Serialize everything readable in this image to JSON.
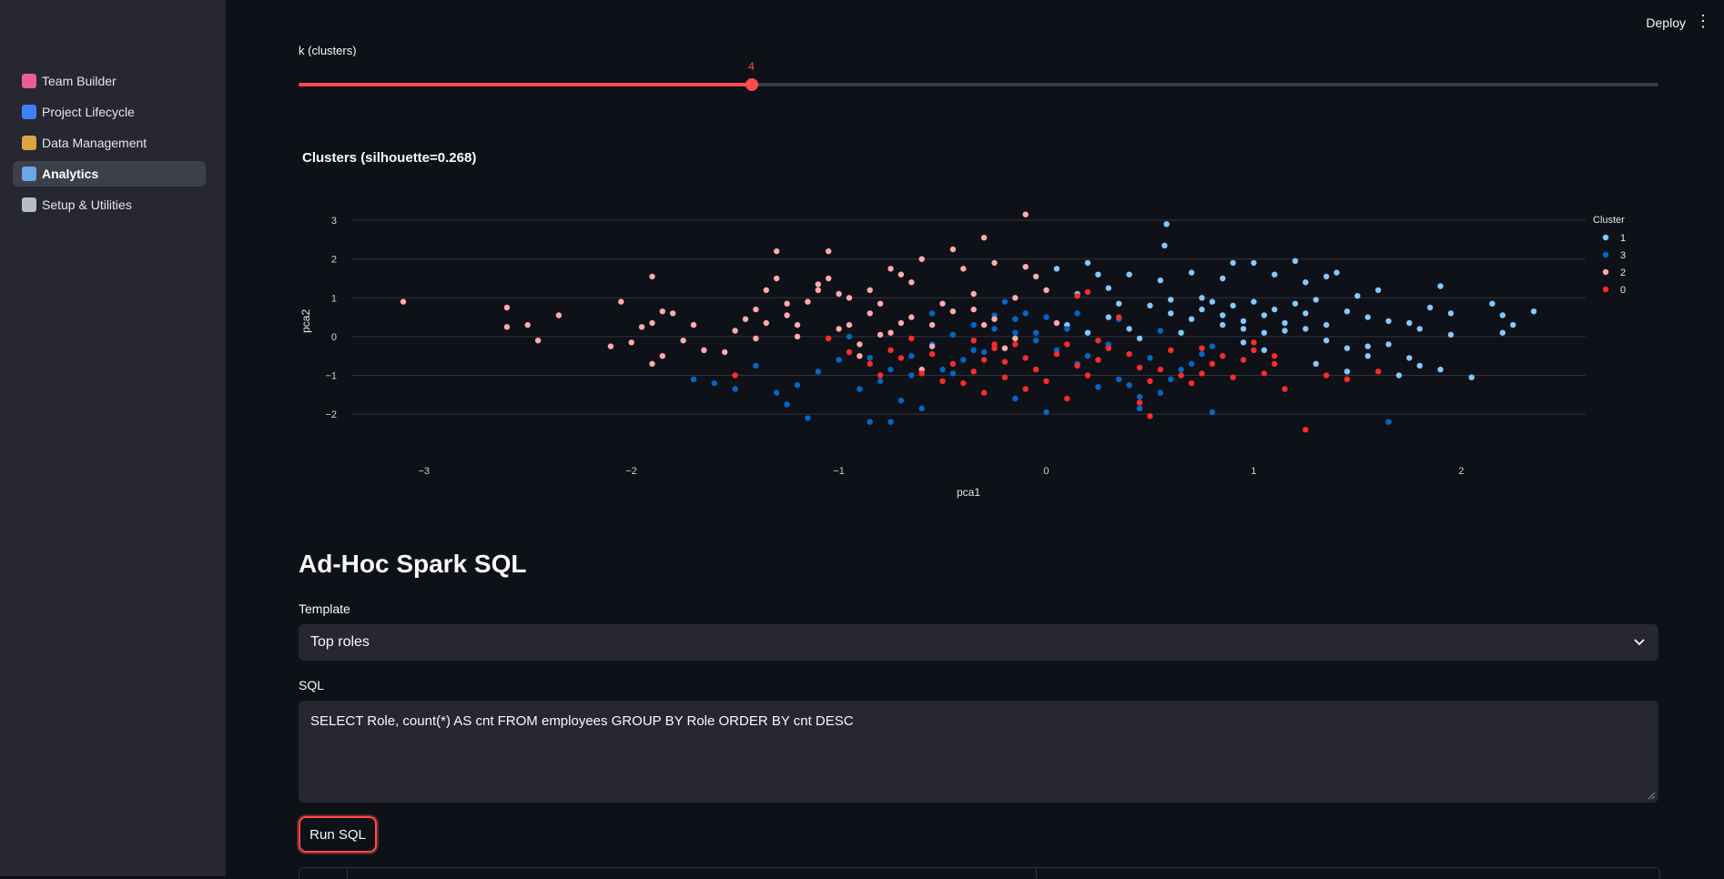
{
  "header": {
    "deploy_label": "Deploy",
    "menu_icon": "kebab-menu-icon"
  },
  "sidebar": {
    "items": [
      {
        "label": "Team Builder",
        "icon": "brain-icon",
        "color": "#e85d9a",
        "active": false
      },
      {
        "label": "Project Lifecycle",
        "icon": "cycle-icon",
        "color": "#3b82f6",
        "active": false
      },
      {
        "label": "Data Management",
        "icon": "file-cabinet-icon",
        "color": "#d9a441",
        "active": false
      },
      {
        "label": "Analytics",
        "icon": "bar-chart-icon",
        "color": "#6aa6e8",
        "active": true
      },
      {
        "label": "Setup & Utilities",
        "icon": "gear-icon",
        "color": "#b8bcc6",
        "active": false
      }
    ]
  },
  "slider": {
    "label": "k (clusters)",
    "value": 4,
    "value_text": "4",
    "min": 2,
    "max": 10,
    "fill_fraction": 0.333
  },
  "chart_title": "Clusters (silhouette=0.268)",
  "chart_data": {
    "type": "scatter",
    "xlabel": "pca1",
    "ylabel": "pca2",
    "xlim": [
      -3.35,
      2.6
    ],
    "ylim": [
      -2.7,
      3.4
    ],
    "xticks": [
      -3,
      -2,
      -1,
      0,
      1,
      2
    ],
    "yticks": [
      -2,
      -1,
      0,
      1,
      2,
      3
    ],
    "grid": true,
    "legend": {
      "title": "Cluster",
      "placement": "top-right"
    },
    "series": [
      {
        "name": "1",
        "color": "#83c9ff",
        "points": [
          [
            0.58,
            2.9
          ],
          [
            0.57,
            2.35
          ],
          [
            0.05,
            1.75
          ],
          [
            0.2,
            1.9
          ],
          [
            0.25,
            1.6
          ],
          [
            0.4,
            1.6
          ],
          [
            0.55,
            1.45
          ],
          [
            0.7,
            1.65
          ],
          [
            0.85,
            1.5
          ],
          [
            0.9,
            1.9
          ],
          [
            1.0,
            1.9
          ],
          [
            1.1,
            1.6
          ],
          [
            1.2,
            1.95
          ],
          [
            1.25,
            1.4
          ],
          [
            1.35,
            1.55
          ],
          [
            1.4,
            1.65
          ],
          [
            1.5,
            1.05
          ],
          [
            0.75,
            1.0
          ],
          [
            0.8,
            0.9
          ],
          [
            0.9,
            0.8
          ],
          [
            1.0,
            0.9
          ],
          [
            1.1,
            0.7
          ],
          [
            1.2,
            0.85
          ],
          [
            1.3,
            0.95
          ],
          [
            1.45,
            0.65
          ],
          [
            1.55,
            0.5
          ],
          [
            1.65,
            0.4
          ],
          [
            1.75,
            0.35
          ],
          [
            1.85,
            0.75
          ],
          [
            1.9,
            1.3
          ],
          [
            1.95,
            0.6
          ],
          [
            2.15,
            0.85
          ],
          [
            2.2,
            0.55
          ],
          [
            2.25,
            0.3
          ],
          [
            2.35,
            0.65
          ],
          [
            0.6,
            0.6
          ],
          [
            0.7,
            0.45
          ],
          [
            0.85,
            0.3
          ],
          [
            0.95,
            0.2
          ],
          [
            1.05,
            0.1
          ],
          [
            1.15,
            0.35
          ],
          [
            1.25,
            0.2
          ],
          [
            1.35,
            -0.1
          ],
          [
            1.45,
            -0.3
          ],
          [
            1.55,
            -0.5
          ],
          [
            1.65,
            -0.2
          ],
          [
            1.75,
            -0.55
          ],
          [
            1.8,
            -0.75
          ],
          [
            1.9,
            -0.85
          ],
          [
            2.05,
            -1.05
          ],
          [
            0.1,
            0.3
          ],
          [
            0.2,
            0.1
          ],
          [
            0.3,
            0.5
          ],
          [
            0.4,
            0.2
          ],
          [
            0.45,
            -0.05
          ],
          [
            0.5,
            0.8
          ],
          [
            0.6,
            0.95
          ],
          [
            0.65,
            0.1
          ],
          [
            0.75,
            0.7
          ],
          [
            0.85,
            0.55
          ],
          [
            0.95,
            0.4
          ],
          [
            1.05,
            0.55
          ],
          [
            1.15,
            0.15
          ],
          [
            1.25,
            0.6
          ],
          [
            1.35,
            0.3
          ],
          [
            0.15,
            1.1
          ],
          [
            0.3,
            1.25
          ],
          [
            1.6,
            1.2
          ],
          [
            1.7,
            -1.0
          ],
          [
            1.3,
            -0.7
          ],
          [
            1.45,
            -0.9
          ],
          [
            1.55,
            -0.25
          ],
          [
            1.95,
            0.05
          ],
          [
            2.2,
            0.1
          ],
          [
            1.8,
            0.2
          ],
          [
            0.95,
            -0.15
          ],
          [
            1.05,
            -0.35
          ],
          [
            0.35,
            0.85
          ]
        ]
      },
      {
        "name": "3",
        "color": "#0068c9",
        "points": [
          [
            -1.15,
            -2.1
          ],
          [
            -0.85,
            -2.2
          ],
          [
            -0.75,
            -2.2
          ],
          [
            -0.7,
            -1.65
          ],
          [
            -0.6,
            -1.85
          ],
          [
            -0.5,
            -0.85
          ],
          [
            -0.4,
            -0.6
          ],
          [
            -0.3,
            -0.4
          ],
          [
            -0.2,
            0.9
          ],
          [
            -0.1,
            0.6
          ],
          [
            0.0,
            0.5
          ],
          [
            0.1,
            0.2
          ],
          [
            0.2,
            -0.5
          ],
          [
            0.3,
            -0.2
          ],
          [
            0.35,
            -1.1
          ],
          [
            0.4,
            -1.25
          ],
          [
            0.5,
            -0.55
          ],
          [
            0.55,
            0.15
          ],
          [
            0.6,
            -1.1
          ],
          [
            0.7,
            -0.7
          ],
          [
            0.8,
            -1.95
          ],
          [
            -1.2,
            -1.25
          ],
          [
            -1.3,
            -1.45
          ],
          [
            -1.4,
            -0.75
          ],
          [
            -1.5,
            -1.35
          ],
          [
            -1.6,
            -1.2
          ],
          [
            -1.7,
            -1.1
          ],
          [
            -1.1,
            -0.9
          ],
          [
            -1.0,
            -0.6
          ],
          [
            -0.9,
            -1.35
          ],
          [
            -0.8,
            -1.15
          ],
          [
            -0.65,
            -1.0
          ],
          [
            -0.55,
            -0.2
          ],
          [
            -0.45,
            0.05
          ],
          [
            -0.35,
            0.3
          ],
          [
            -0.25,
            0.55
          ],
          [
            -0.15,
            0.45
          ],
          [
            -0.05,
            0.1
          ],
          [
            0.05,
            -0.35
          ],
          [
            0.15,
            -0.7
          ],
          [
            0.25,
            -1.3
          ],
          [
            0.45,
            -1.55
          ],
          [
            0.55,
            -1.45
          ],
          [
            0.65,
            -0.85
          ],
          [
            0.75,
            -0.45
          ],
          [
            0.8,
            -0.25
          ],
          [
            -0.95,
            0.0
          ],
          [
            -0.85,
            -0.55
          ],
          [
            -0.75,
            -0.85
          ],
          [
            -0.65,
            -0.5
          ],
          [
            -0.55,
            0.6
          ],
          [
            -0.45,
            -0.95
          ],
          [
            -0.35,
            -0.35
          ],
          [
            -0.25,
            0.2
          ],
          [
            -0.15,
            0.1
          ],
          [
            -0.05,
            -0.1
          ],
          [
            0.35,
            0.45
          ],
          [
            0.15,
            0.6
          ],
          [
            1.65,
            -2.2
          ],
          [
            -1.25,
            -1.75
          ],
          [
            -0.15,
            -1.6
          ],
          [
            0.0,
            -1.95
          ],
          [
            0.45,
            -1.85
          ]
        ]
      },
      {
        "name": "2",
        "color": "#ffabab",
        "points": [
          [
            -3.1,
            0.9
          ],
          [
            -2.6,
            0.75
          ],
          [
            -2.6,
            0.25
          ],
          [
            -2.5,
            0.3
          ],
          [
            -2.45,
            -0.1
          ],
          [
            -2.35,
            0.55
          ],
          [
            -2.1,
            -0.25
          ],
          [
            -2.05,
            0.9
          ],
          [
            -2.0,
            -0.15
          ],
          [
            -1.95,
            0.25
          ],
          [
            -1.9,
            1.55
          ],
          [
            -1.9,
            0.35
          ],
          [
            -1.85,
            0.65
          ],
          [
            -1.8,
            0.6
          ],
          [
            -1.85,
            -0.5
          ],
          [
            -1.9,
            -0.7
          ],
          [
            -1.75,
            -0.1
          ],
          [
            -1.7,
            0.3
          ],
          [
            -1.65,
            -0.35
          ],
          [
            -1.5,
            0.15
          ],
          [
            -1.45,
            0.45
          ],
          [
            -1.4,
            0.7
          ],
          [
            -1.35,
            1.2
          ],
          [
            -1.3,
            1.5
          ],
          [
            -1.3,
            2.2
          ],
          [
            -1.25,
            0.55
          ],
          [
            -1.2,
            0.3
          ],
          [
            -1.15,
            0.9
          ],
          [
            -1.1,
            1.35
          ],
          [
            -1.05,
            2.2
          ],
          [
            -1.05,
            1.5
          ],
          [
            -1.0,
            1.1
          ],
          [
            -0.95,
            0.3
          ],
          [
            -0.9,
            -0.5
          ],
          [
            -0.85,
            1.2
          ],
          [
            -0.8,
            0.85
          ],
          [
            -0.75,
            1.75
          ],
          [
            -0.7,
            1.6
          ],
          [
            -0.65,
            1.4
          ],
          [
            -0.6,
            2.0
          ],
          [
            -0.55,
            0.3
          ],
          [
            -0.5,
            0.85
          ],
          [
            -0.45,
            2.25
          ],
          [
            -0.4,
            1.75
          ],
          [
            -0.35,
            0.7
          ],
          [
            -0.3,
            0.3
          ],
          [
            -0.25,
            1.9
          ],
          [
            -0.2,
            -0.3
          ],
          [
            -0.15,
            1.0
          ],
          [
            -0.1,
            1.8
          ],
          [
            -0.05,
            1.55
          ],
          [
            -0.1,
            3.15
          ],
          [
            0.0,
            1.2
          ],
          [
            0.05,
            0.35
          ],
          [
            -0.6,
            -0.85
          ],
          [
            -0.65,
            0.5
          ],
          [
            -0.55,
            -0.25
          ],
          [
            -0.45,
            0.65
          ],
          [
            -0.35,
            1.1
          ],
          [
            -0.25,
            0.45
          ],
          [
            -0.15,
            -0.05
          ],
          [
            -1.4,
            -0.05
          ],
          [
            -1.35,
            0.35
          ],
          [
            -1.2,
            0.0
          ],
          [
            -1.1,
            1.2
          ],
          [
            -0.95,
            1.0
          ],
          [
            -0.85,
            0.6
          ],
          [
            -1.0,
            0.2
          ],
          [
            -0.8,
            0.05
          ],
          [
            -0.7,
            0.35
          ],
          [
            -0.3,
            2.55
          ],
          [
            -1.55,
            -0.4
          ],
          [
            -1.25,
            0.85
          ],
          [
            -0.9,
            -0.2
          ],
          [
            -0.75,
            0.1
          ]
        ]
      },
      {
        "name": "0",
        "color": "#ff2b2b",
        "points": [
          [
            -1.5,
            -1.0
          ],
          [
            -1.05,
            -0.05
          ],
          [
            -0.95,
            -0.4
          ],
          [
            -0.85,
            -0.7
          ],
          [
            -0.75,
            -0.35
          ],
          [
            -0.65,
            -0.05
          ],
          [
            -0.55,
            -0.45
          ],
          [
            -0.45,
            -0.7
          ],
          [
            -0.35,
            -0.9
          ],
          [
            -0.3,
            -0.6
          ],
          [
            -0.25,
            -0.3
          ],
          [
            -0.2,
            -1.05
          ],
          [
            -0.15,
            -0.2
          ],
          [
            -0.1,
            -0.55
          ],
          [
            -0.05,
            -0.85
          ],
          [
            0.0,
            -1.15
          ],
          [
            0.05,
            -0.45
          ],
          [
            0.1,
            -0.2
          ],
          [
            0.15,
            -0.75
          ],
          [
            0.2,
            -1.0
          ],
          [
            0.25,
            -0.6
          ],
          [
            0.3,
            -0.3
          ],
          [
            0.35,
            0.5
          ],
          [
            0.4,
            -0.45
          ],
          [
            0.45,
            -0.8
          ],
          [
            0.5,
            -1.15
          ],
          [
            0.55,
            -0.85
          ],
          [
            0.6,
            -0.35
          ],
          [
            0.65,
            -1.0
          ],
          [
            0.7,
            -1.2
          ],
          [
            0.75,
            -0.95
          ],
          [
            0.8,
            -0.7
          ],
          [
            0.85,
            -0.5
          ],
          [
            0.9,
            -1.05
          ],
          [
            0.95,
            -0.6
          ],
          [
            1.0,
            -0.35
          ],
          [
            1.05,
            -0.95
          ],
          [
            1.1,
            -0.7
          ],
          [
            1.15,
            -1.35
          ],
          [
            1.25,
            -2.4
          ],
          [
            1.35,
            -1.0
          ],
          [
            1.45,
            -1.1
          ],
          [
            1.6,
            -0.9
          ],
          [
            -0.8,
            -1.0
          ],
          [
            -0.7,
            -0.55
          ],
          [
            -0.6,
            -0.95
          ],
          [
            -0.5,
            -1.15
          ],
          [
            -0.4,
            -1.2
          ],
          [
            -0.3,
            -1.45
          ],
          [
            -0.2,
            -0.65
          ],
          [
            -0.1,
            -1.35
          ],
          [
            0.1,
            -1.6
          ],
          [
            0.2,
            1.15
          ],
          [
            0.15,
            1.05
          ],
          [
            -0.35,
            -0.1
          ],
          [
            0.5,
            -2.05
          ],
          [
            0.45,
            -1.7
          ],
          [
            0.75,
            -0.3
          ],
          [
            0.25,
            -0.1
          ],
          [
            -0.25,
            -0.2
          ],
          [
            1.0,
            -0.15
          ],
          [
            1.1,
            -0.5
          ]
        ]
      }
    ]
  },
  "sql_section": {
    "heading": "Ad-Hoc Spark SQL",
    "template_label": "Template",
    "template_value": "Top roles",
    "sql_label": "SQL",
    "sql_value": "SELECT Role, count(*) AS cnt FROM employees GROUP BY Role ORDER BY cnt DESC",
    "run_button": "Run SQL"
  }
}
